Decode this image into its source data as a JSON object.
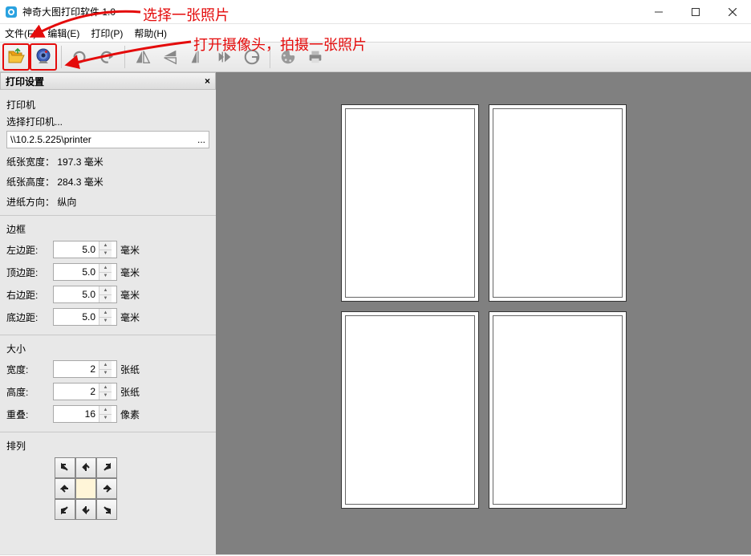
{
  "title": "神奇大图打印软件 1.0",
  "annotations": {
    "open_tip": "选择一张照片",
    "camera_tip": "打开摄像头，拍摄一张照片"
  },
  "menus": {
    "file": "文件(F)",
    "edit": "编辑(E)",
    "print": "打印(P)",
    "help": "帮助(H)"
  },
  "settings": {
    "panel_title": "打印设置",
    "printer_section": "打印机",
    "select_printer": "选择打印机...",
    "printer_value": "\\\\10.2.5.225\\printer",
    "paper_width_label": "纸张宽度：",
    "paper_width_value": "197.3 毫米",
    "paper_height_label": "纸张高度：",
    "paper_height_value": "284.3 毫米",
    "feed_dir_label": "进纸方向：",
    "feed_dir_value": "纵向",
    "margin_section": "边框",
    "margin_left_label": "左边距:",
    "margin_top_label": "顶边距:",
    "margin_right_label": "右边距:",
    "margin_bottom_label": "底边距:",
    "margin_left_value": "5.0",
    "margin_top_value": "5.0",
    "margin_right_value": "5.0",
    "margin_bottom_value": "5.0",
    "mm_unit": "毫米",
    "size_section": "大小",
    "width_label": "宽度:",
    "height_label": "高度:",
    "overlap_label": "重叠:",
    "width_value": "2",
    "height_value": "2",
    "overlap_value": "16",
    "sheet_unit": "张纸",
    "pixel_unit": "像素",
    "arrange_section": "排列"
  }
}
